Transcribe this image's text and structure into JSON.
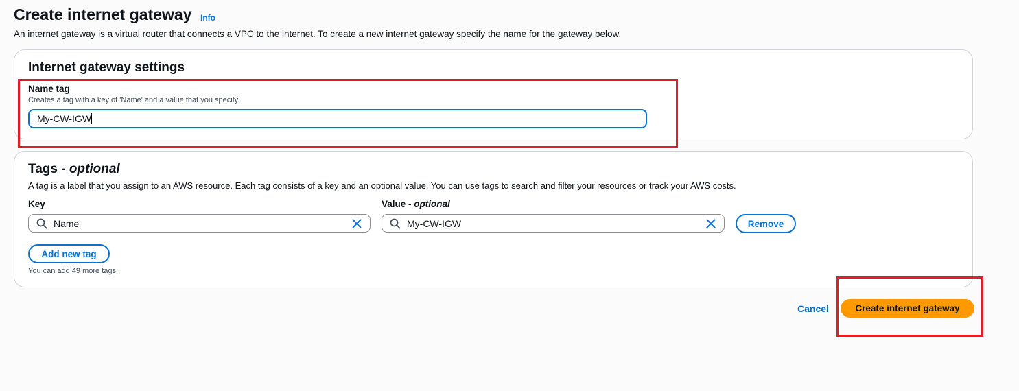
{
  "header": {
    "title": "Create internet gateway",
    "info_label": "Info",
    "description": "An internet gateway is a virtual router that connects a VPC to the internet. To create a new internet gateway specify the name for the gateway below."
  },
  "settings": {
    "title": "Internet gateway settings",
    "name_tag_label": "Name tag",
    "name_tag_hint": "Creates a tag with a key of 'Name' and a value that you specify.",
    "name_tag_value": "My-CW-IGW"
  },
  "tags": {
    "title": "Tags - ",
    "title_optional": "optional",
    "description": "A tag is a label that you assign to an AWS resource. Each tag consists of a key and an optional value. You can use tags to search and filter your resources or track your AWS costs.",
    "key_label": "Key",
    "value_label": "Value - ",
    "value_label_optional": "optional",
    "rows": [
      {
        "key": "Name",
        "value": "My-CW-IGW"
      }
    ],
    "remove_label": "Remove",
    "add_label": "Add new tag",
    "limit_hint": "You can add 49 more tags."
  },
  "footer": {
    "cancel_label": "Cancel",
    "create_label": "Create internet gateway"
  },
  "icons": {
    "search": "search-icon",
    "clear": "close-icon"
  },
  "colors": {
    "accent": "#0972d3",
    "primary_button": "#ff9900",
    "highlight": "#e21f26"
  }
}
